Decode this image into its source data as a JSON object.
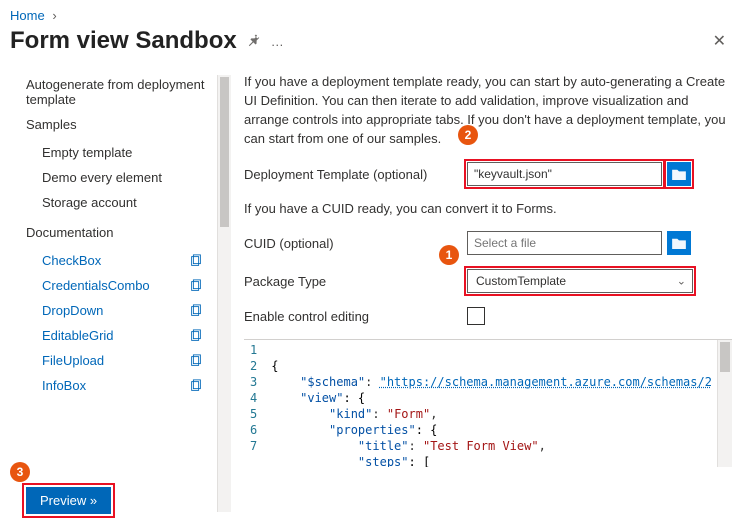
{
  "breadcrumb": {
    "home": "Home"
  },
  "header": {
    "title": "Form view Sandbox"
  },
  "sidebar": {
    "autogen": "Autogenerate from deployment template",
    "samples_label": "Samples",
    "samples": [
      {
        "label": "Empty template"
      },
      {
        "label": "Demo every element"
      },
      {
        "label": "Storage account"
      }
    ],
    "docs_label": "Documentation",
    "docs": [
      {
        "label": "CheckBox"
      },
      {
        "label": "CredentialsCombo"
      },
      {
        "label": "DropDown"
      },
      {
        "label": "EditableGrid"
      },
      {
        "label": "FileUpload"
      },
      {
        "label": "InfoBox"
      }
    ]
  },
  "content": {
    "intro": "If you have a deployment template ready, you can start by auto-generating a Create UI Definition. You can then iterate to add validation, improve visualization and arrange controls into appropriate tabs. If you don't have a deployment template, you can start from one of our samples.",
    "deploy_label": "Deployment Template (optional)",
    "deploy_value": "\"keyvault.json\"",
    "cuid_intro": "If you have a CUID ready, you can convert it to Forms.",
    "cuid_label": "CUID (optional)",
    "cuid_placeholder": "Select a file",
    "package_label": "Package Type",
    "package_value": "CustomTemplate",
    "enable_label": "Enable control editing"
  },
  "callouts": {
    "c1": "1",
    "c2": "2",
    "c3": "3"
  },
  "footer": {
    "preview": "Preview »"
  },
  "editor": {
    "lines": [
      "1",
      "2",
      "3",
      "4",
      "5",
      "6",
      "7"
    ],
    "l1": "{",
    "l2a": "    \"$schema\"",
    "l2b": ": ",
    "l2c": "\"https://schema.management.azure.com/schemas/2",
    "l3a": "    \"view\"",
    "l3b": ": {",
    "l4a": "        \"kind\"",
    "l4b": ": ",
    "l4c": "\"Form\"",
    "l4d": ",",
    "l5a": "        \"properties\"",
    "l5b": ": {",
    "l6a": "            \"title\"",
    "l6b": ": ",
    "l6c": "\"Test Form View\"",
    "l6d": ",",
    "l7a": "            \"steps\"",
    "l7b": ": ["
  }
}
